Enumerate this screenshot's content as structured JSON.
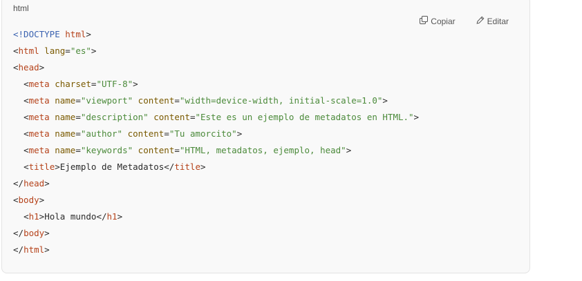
{
  "code_block": {
    "language": "html",
    "copy_label": "Copiar",
    "edit_label": "Editar",
    "copy_icon": "copy-icon",
    "edit_icon": "pencil-icon",
    "lines": [
      [
        {
          "t": "doctype",
          "v": "<!DOCTYPE"
        },
        {
          "t": "text",
          "v": " "
        },
        {
          "t": "tag",
          "v": "html"
        },
        {
          "t": "punct",
          "v": ">"
        }
      ],
      [
        {
          "t": "punct",
          "v": "<"
        },
        {
          "t": "tag",
          "v": "html"
        },
        {
          "t": "text",
          "v": " "
        },
        {
          "t": "attr",
          "v": "lang"
        },
        {
          "t": "punct",
          "v": "="
        },
        {
          "t": "str",
          "v": "\"es\""
        },
        {
          "t": "punct",
          "v": ">"
        }
      ],
      [
        {
          "t": "punct",
          "v": "<"
        },
        {
          "t": "tag",
          "v": "head"
        },
        {
          "t": "punct",
          "v": ">"
        }
      ],
      [
        {
          "t": "text",
          "v": "  "
        },
        {
          "t": "punct",
          "v": "<"
        },
        {
          "t": "tag",
          "v": "meta"
        },
        {
          "t": "text",
          "v": " "
        },
        {
          "t": "attr",
          "v": "charset"
        },
        {
          "t": "punct",
          "v": "="
        },
        {
          "t": "str",
          "v": "\"UTF-8\""
        },
        {
          "t": "punct",
          "v": ">"
        }
      ],
      [
        {
          "t": "text",
          "v": "  "
        },
        {
          "t": "punct",
          "v": "<"
        },
        {
          "t": "tag",
          "v": "meta"
        },
        {
          "t": "text",
          "v": " "
        },
        {
          "t": "attr",
          "v": "name"
        },
        {
          "t": "punct",
          "v": "="
        },
        {
          "t": "str",
          "v": "\"viewport\""
        },
        {
          "t": "text",
          "v": " "
        },
        {
          "t": "attr",
          "v": "content"
        },
        {
          "t": "punct",
          "v": "="
        },
        {
          "t": "str",
          "v": "\"width=device-width, initial-scale=1.0\""
        },
        {
          "t": "punct",
          "v": ">"
        }
      ],
      [
        {
          "t": "text",
          "v": "  "
        },
        {
          "t": "punct",
          "v": "<"
        },
        {
          "t": "tag",
          "v": "meta"
        },
        {
          "t": "text",
          "v": " "
        },
        {
          "t": "attr",
          "v": "name"
        },
        {
          "t": "punct",
          "v": "="
        },
        {
          "t": "str",
          "v": "\"description\""
        },
        {
          "t": "text",
          "v": " "
        },
        {
          "t": "attr",
          "v": "content"
        },
        {
          "t": "punct",
          "v": "="
        },
        {
          "t": "str",
          "v": "\"Este es un ejemplo de metadatos en HTML.\""
        },
        {
          "t": "punct",
          "v": ">"
        }
      ],
      [
        {
          "t": "text",
          "v": "  "
        },
        {
          "t": "punct",
          "v": "<"
        },
        {
          "t": "tag",
          "v": "meta"
        },
        {
          "t": "text",
          "v": " "
        },
        {
          "t": "attr",
          "v": "name"
        },
        {
          "t": "punct",
          "v": "="
        },
        {
          "t": "str",
          "v": "\"author\""
        },
        {
          "t": "text",
          "v": " "
        },
        {
          "t": "attr",
          "v": "content"
        },
        {
          "t": "punct",
          "v": "="
        },
        {
          "t": "str",
          "v": "\"Tu amorcito\""
        },
        {
          "t": "punct",
          "v": ">"
        }
      ],
      [
        {
          "t": "text",
          "v": "  "
        },
        {
          "t": "punct",
          "v": "<"
        },
        {
          "t": "tag",
          "v": "meta"
        },
        {
          "t": "text",
          "v": " "
        },
        {
          "t": "attr",
          "v": "name"
        },
        {
          "t": "punct",
          "v": "="
        },
        {
          "t": "str",
          "v": "\"keywords\""
        },
        {
          "t": "text",
          "v": " "
        },
        {
          "t": "attr",
          "v": "content"
        },
        {
          "t": "punct",
          "v": "="
        },
        {
          "t": "str",
          "v": "\"HTML, metadatos, ejemplo, head\""
        },
        {
          "t": "punct",
          "v": ">"
        }
      ],
      [
        {
          "t": "text",
          "v": "  "
        },
        {
          "t": "punct",
          "v": "<"
        },
        {
          "t": "tag",
          "v": "title"
        },
        {
          "t": "punct",
          "v": ">"
        },
        {
          "t": "text",
          "v": "Ejemplo de Metadatos"
        },
        {
          "t": "punct",
          "v": "</"
        },
        {
          "t": "tag",
          "v": "title"
        },
        {
          "t": "punct",
          "v": ">"
        }
      ],
      [
        {
          "t": "punct",
          "v": "</"
        },
        {
          "t": "tag",
          "v": "head"
        },
        {
          "t": "punct",
          "v": ">"
        }
      ],
      [
        {
          "t": "punct",
          "v": "<"
        },
        {
          "t": "tag",
          "v": "body"
        },
        {
          "t": "punct",
          "v": ">"
        }
      ],
      [
        {
          "t": "text",
          "v": "  "
        },
        {
          "t": "punct",
          "v": "<"
        },
        {
          "t": "tag",
          "v": "h1"
        },
        {
          "t": "punct",
          "v": ">"
        },
        {
          "t": "text",
          "v": "Hola mundo"
        },
        {
          "t": "punct",
          "v": "</"
        },
        {
          "t": "tag",
          "v": "h1"
        },
        {
          "t": "punct",
          "v": ">"
        }
      ],
      [
        {
          "t": "punct",
          "v": "</"
        },
        {
          "t": "tag",
          "v": "body"
        },
        {
          "t": "punct",
          "v": ">"
        }
      ],
      [
        {
          "t": "punct",
          "v": "</"
        },
        {
          "t": "tag",
          "v": "html"
        },
        {
          "t": "punct",
          "v": ">"
        }
      ]
    ]
  },
  "colors": {
    "tag": "#b5421a",
    "doctype": "#3a62b0",
    "attr": "#7a5a00",
    "string": "#4b8a3a",
    "text": "#2b2b2b",
    "card_bg": "#f9f9f9"
  }
}
